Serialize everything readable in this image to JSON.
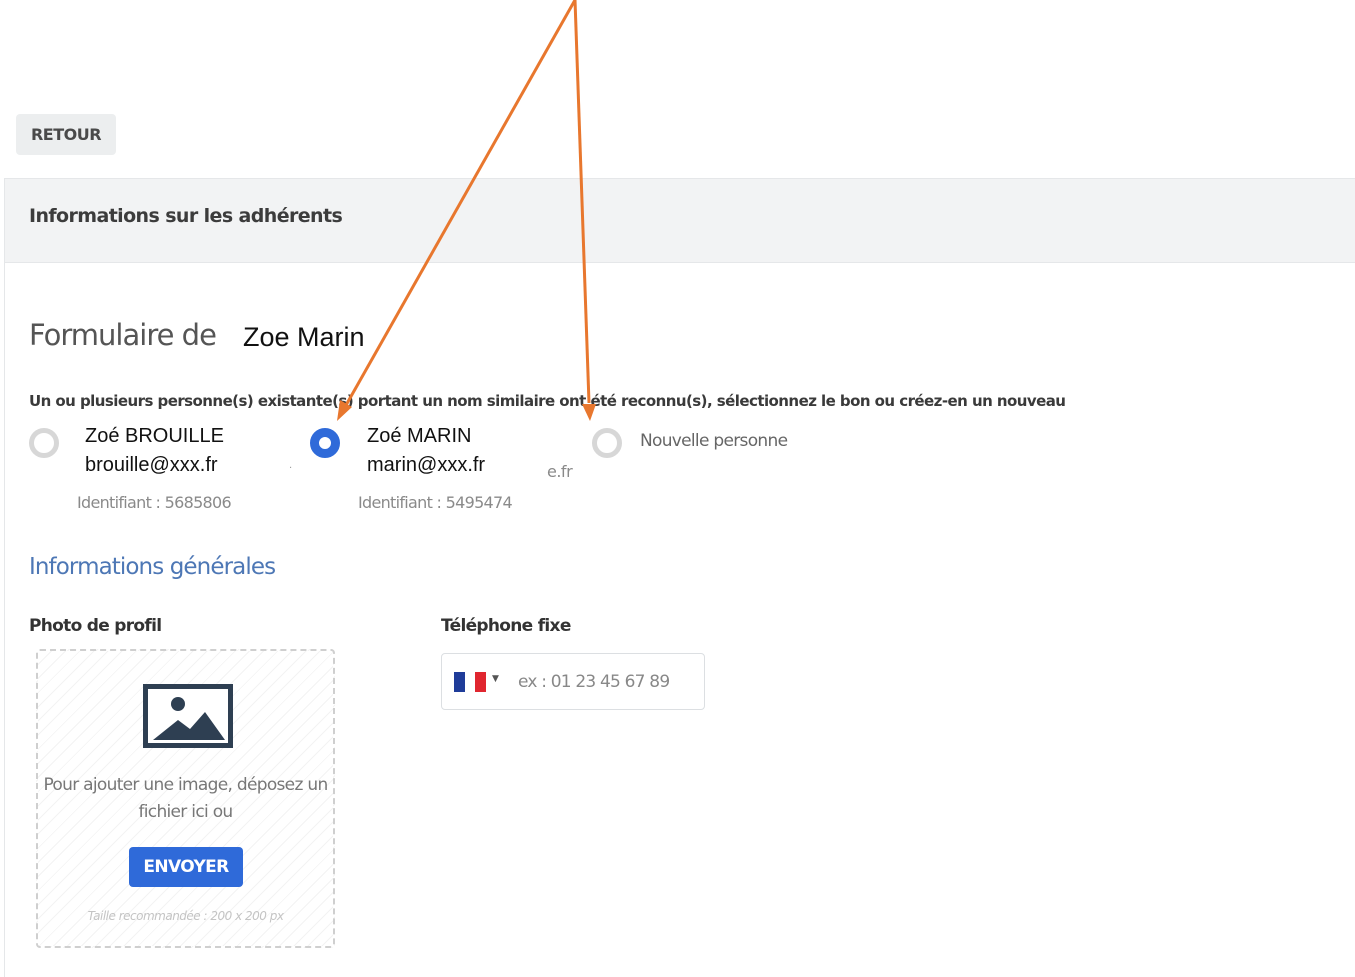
{
  "toolbar": {
    "back_label": "RETOUR"
  },
  "panel": {
    "title": "Informations sur les adhérents"
  },
  "form": {
    "heading": "Formulaire de",
    "heading_name": "Zoe Marin",
    "match_notice": "Un ou plusieurs personne(s) existante(s) portant un nom similaire ont été reconnu(s), sélectionnez le bon ou créez-en un nouveau"
  },
  "matches": [
    {
      "name": "Zoé BROUILLE",
      "email": "brouille@xxx.fr",
      "identifier": "Identifiant : 5685806",
      "selected": false
    },
    {
      "name": "Zoé MARIN",
      "email": "marin@xxx.fr",
      "identifier": "Identifiant : 5495474",
      "selected": true
    }
  ],
  "residual_text": "e.fr",
  "new_person": {
    "label": "Nouvelle personne",
    "selected": false
  },
  "general_section": {
    "title": "Informations générales"
  },
  "photo": {
    "label": "Photo de profil",
    "drop_text": "Pour ajouter une image, déposez un fichier ici ou",
    "upload_label": "ENVOYER",
    "hint": "Taille recommandée : 200 x 200 px",
    "icon": "image-icon"
  },
  "phone": {
    "label": "Téléphone fixe",
    "country_flag": "flag-fr-icon",
    "placeholder": "ex : 01 23 45 67 89",
    "value": ""
  },
  "colors": {
    "accent": "#2f6ad9",
    "section_title": "#4d77b5",
    "annotation_arrow": "#e8772e",
    "flag_blue": "#1f3c99",
    "flag_white": "#ffffff",
    "flag_red": "#e0262f"
  }
}
